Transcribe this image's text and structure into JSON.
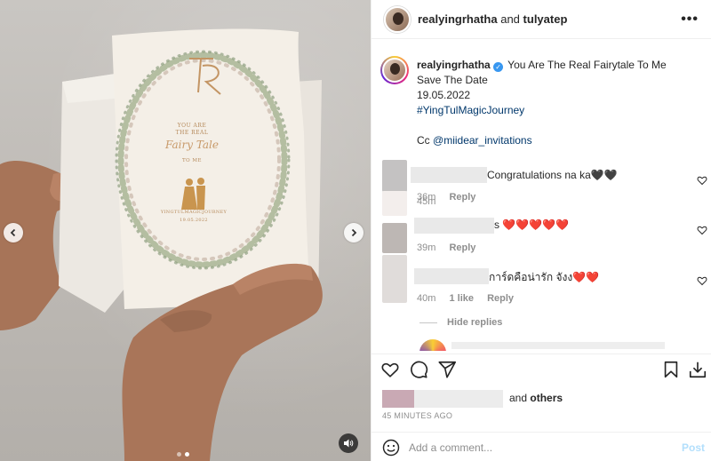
{
  "post": {
    "header": {
      "author": "realyingrhatha",
      "and_text": "and",
      "collaborator": "tulyatep",
      "more_icon": "more-horizontal-icon"
    },
    "media": {
      "card_texts": {
        "you_are": "YOU ARE",
        "the_real": "THE REAL",
        "fairy_tale": "Fairy Tale",
        "to_me": "TO ME",
        "journey": "YINGTULMAGICJOURNEY",
        "date": "19.05.2022",
        "monogram": "TR"
      },
      "carousel_dots": 2,
      "active_dot": 1,
      "prev_icon": "chevron-left-icon",
      "next_icon": "chevron-right-icon",
      "mute_icon": "speaker-icon"
    },
    "caption": {
      "username": "realyingrhatha",
      "verified_icon": "verified-badge-icon",
      "line1": "You Are The Real Fairytale To Me",
      "line2": "Save The Date",
      "line3": "19.05.2022",
      "hashtag": "#YingTulMagicJourney",
      "cc_prefix": "Cc",
      "mention": "@miidear_invitations",
      "time": "45m"
    },
    "comments": [
      {
        "text": "Congratulations na ka🖤🖤",
        "time": "36m",
        "reply": "Reply"
      },
      {
        "text": "s ❤️❤️❤️❤️❤️",
        "time": "39m",
        "reply": "Reply"
      },
      {
        "text": "การ์ดคือน่ารัก จังง❤️❤️",
        "time": "40m",
        "likes": "1 like",
        "reply": "Reply"
      }
    ],
    "hide_replies": "Hide replies",
    "actions": {
      "like_icon": "heart-icon",
      "comment_icon": "comment-icon",
      "share_icon": "send-icon",
      "save_icon": "bookmark-icon",
      "download_icon": "download-icon"
    },
    "likes": {
      "and_text": "and",
      "others": "others"
    },
    "time_ago": "45 MINUTES AGO",
    "add_comment": {
      "emoji_icon": "smiley-icon",
      "placeholder": "Add a comment...",
      "post_label": "Post"
    },
    "colors": {
      "link": "#00376b",
      "verified": "#3897f0",
      "post_button": "#b2dffc",
      "heart_red": "#ed4956"
    }
  }
}
